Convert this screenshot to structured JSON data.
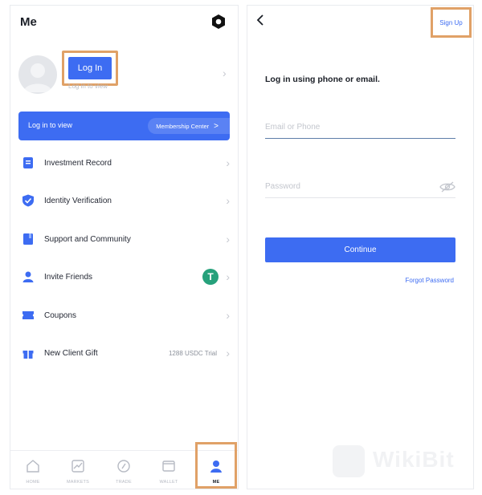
{
  "left": {
    "title": "Me",
    "login_button": "Log In",
    "login_sub": "Log in to view",
    "banner": {
      "text": "Log in to view",
      "membership": "Membership Center",
      "membership_arrow": ">"
    },
    "menu": [
      {
        "label": "Investment Record",
        "icon": "document-icon",
        "meta": ""
      },
      {
        "label": "Identity Verification",
        "icon": "shield-check-icon",
        "meta": ""
      },
      {
        "label": "Support and Community",
        "icon": "book-icon",
        "meta": ""
      },
      {
        "label": "Invite Friends",
        "icon": "person-icon",
        "meta": ""
      },
      {
        "label": "Coupons",
        "icon": "coupon-icon",
        "meta": ""
      },
      {
        "label": "New Client Gift",
        "icon": "gift-icon",
        "meta": "1288 USDC Trial"
      }
    ],
    "tether_symbol": "T",
    "tabs": [
      {
        "label": "HOME",
        "icon": "home-icon"
      },
      {
        "label": "MARKETS",
        "icon": "chart-icon"
      },
      {
        "label": "TRADE",
        "icon": "trade-icon"
      },
      {
        "label": "WALLET",
        "icon": "wallet-icon"
      },
      {
        "label": "ME",
        "icon": "profile-icon"
      }
    ]
  },
  "right": {
    "sign_up": "Sign Up",
    "headline": "Log in using phone or email.",
    "email_placeholder": "Email or Phone",
    "password_placeholder": "Password",
    "continue": "Continue",
    "forgot": "Forgot Password"
  },
  "watermark": "WikiBit",
  "colors": {
    "accent": "#3d6cf2",
    "highlight_box": "#e0a167",
    "tether": "#26a17b"
  }
}
